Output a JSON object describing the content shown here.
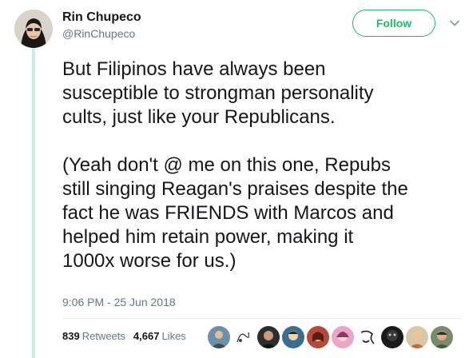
{
  "author": {
    "name": "Rin Chupeco",
    "handle": "@RinChupeco"
  },
  "follow_label": "Follow",
  "tweet": {
    "lines_p1": [
      "But Filipinos have always been",
      "susceptible to strongman personality",
      "cults, just like your Republicans."
    ],
    "lines_p2": [
      "(Yeah don't @ me on this one, Repubs",
      "still singing Reagan's praises despite the",
      "fact he was FRIENDS with Marcos and",
      "helped him retain power, making it",
      "1000x worse for us.)"
    ]
  },
  "timestamp": "9:06 PM - 25 Jun 2018",
  "stats": {
    "retweets_count": "839",
    "retweets_label": "Retweets",
    "likes_count": "4,667",
    "likes_label": "Likes"
  },
  "colors": {
    "follow_green": "#17bf63",
    "thread_line": "#c8ecdf",
    "secondary_text": "#657786"
  },
  "icons": {
    "menu": "chevron-down-icon"
  }
}
